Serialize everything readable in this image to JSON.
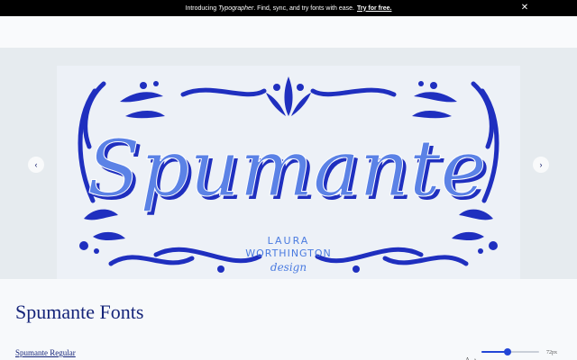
{
  "promo": {
    "intro": "Introducing",
    "product": "Typographer",
    "rest": ". Find, sync, and try fonts with ease.",
    "cta": "Try for free.",
    "close_glyph": "✕"
  },
  "carousel": {
    "prev_glyph": "‹",
    "next_glyph": "›",
    "specimen": {
      "word": "Spumante",
      "credit_line1": "LAURA",
      "credit_line2": "WORTHINGTON",
      "credit_line3": "design",
      "colors": {
        "ornament": "#1f2fbf",
        "word_fill": "#5b82e6",
        "word_shadow": "#1f2fbf",
        "credit": "#4a7be0"
      }
    }
  },
  "page": {
    "title": "Spumante Fonts"
  },
  "styles": {
    "first_style": "Spumante Regular"
  },
  "size_control": {
    "glyph_big": "A",
    "glyph_small": "A",
    "value_fraction": 0.45,
    "value_label": "72px"
  }
}
